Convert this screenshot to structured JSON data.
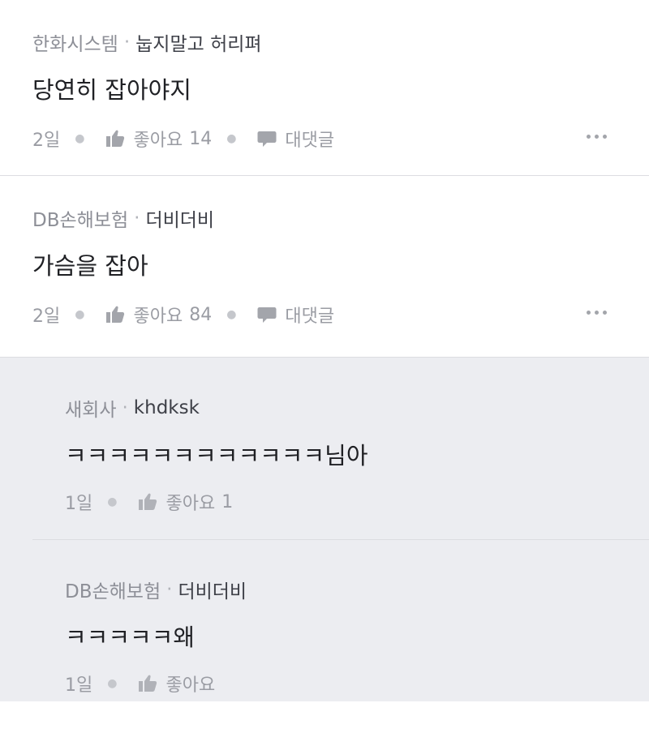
{
  "comments": [
    {
      "company": "한화시스템",
      "separator": "·",
      "nickname": "눕지말고 허리펴",
      "text": "당연히 잡아야지",
      "time": "2일",
      "like_label": "좋아요",
      "like_count": "14",
      "reply_label": "대댓글"
    },
    {
      "company": "DB손해보험",
      "separator": "·",
      "nickname": "더비더비",
      "text": "가슴을 잡아",
      "time": "2일",
      "like_label": "좋아요",
      "like_count": "84",
      "reply_label": "대댓글"
    }
  ],
  "replies": [
    {
      "company": "새회사",
      "separator": "·",
      "nickname": "khdksk",
      "text": "ㅋㅋㅋㅋㅋㅋㅋㅋㅋㅋㅋㅋ님아",
      "time": "1일",
      "like_label": "좋아요",
      "like_count": "1"
    },
    {
      "company": "DB손해보험",
      "separator": "·",
      "nickname": "더비더비",
      "text": "ㅋㅋㅋㅋㅋ왜",
      "time": "1일",
      "like_label": "좋아요",
      "like_count": ""
    }
  ],
  "icons": {
    "like": "thumbs-up-icon",
    "comment": "speech-bubble-icon",
    "more": "more-dots-icon"
  },
  "colors": {
    "reply_background": "#ecedf1",
    "divider": "#dcdde1"
  }
}
